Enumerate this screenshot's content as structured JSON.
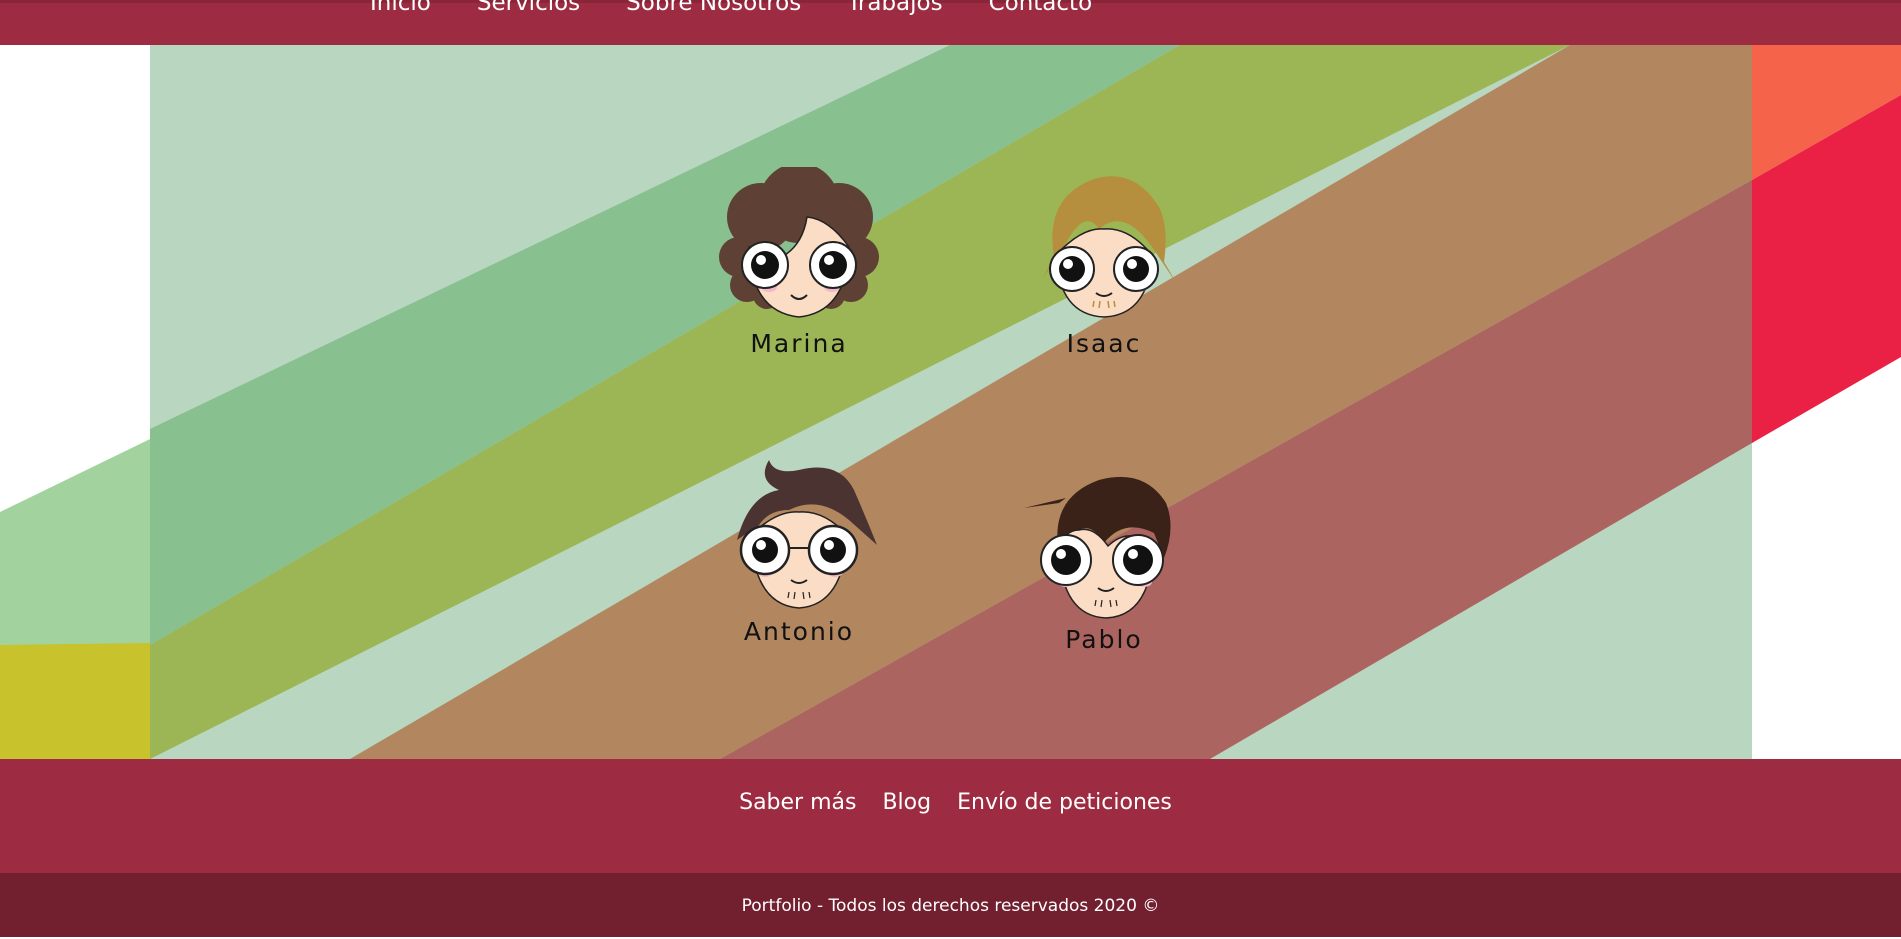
{
  "nav": {
    "items": [
      {
        "label": "Inicio"
      },
      {
        "label": "Servicios"
      },
      {
        "label": "Sobre Nosotros"
      },
      {
        "label": "Trabajos"
      },
      {
        "label": "Contacto"
      }
    ]
  },
  "team": {
    "members": [
      {
        "name": "Marina",
        "hair": "#5e4035",
        "style": "curly"
      },
      {
        "name": "Isaac",
        "hair": "#b58f3e",
        "style": "fringe"
      },
      {
        "name": "Antonio",
        "hair": "#4a3330",
        "style": "swoop",
        "glasses": true
      },
      {
        "name": "Pablo",
        "hair": "#3a2218",
        "style": "short"
      }
    ]
  },
  "footer": {
    "links": [
      {
        "label": "Saber más"
      },
      {
        "label": "Blog"
      },
      {
        "label": "Envío de peticiones"
      }
    ],
    "copyright": "Portfolio - Todos los derechos reservados 2020 ©"
  },
  "colors": {
    "brand": "#9d2c42",
    "brand_dark": "#722030",
    "stripe_green_light": "#b8d6c0",
    "stripe_green": "#89c08f",
    "stripe_olive": "#9db655",
    "stripe_brown": "#b28760",
    "stripe_red": "#ac6460",
    "accent_yellow": "#c8c22c",
    "accent_crimson": "#ea2144",
    "accent_orange": "#f4634a"
  }
}
